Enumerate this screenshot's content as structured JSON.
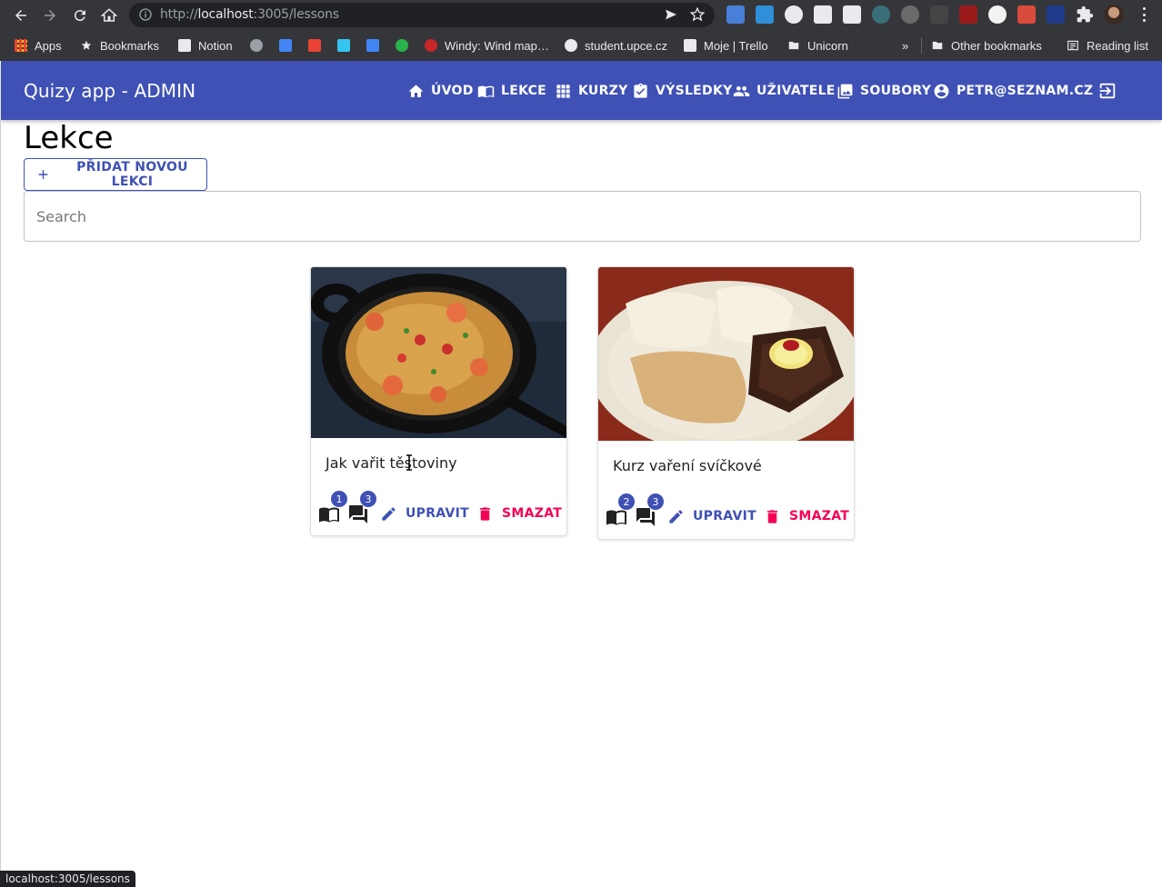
{
  "browser": {
    "url_prefix": "http://",
    "url_host": "localhost",
    "url_rest": ":3005/lessons",
    "bookmarks": {
      "apps": "Apps",
      "bookmarks": "Bookmarks",
      "notion": "Notion",
      "windy": "Windy: Wind map…",
      "student": "student.upce.cz",
      "trello": "Moje | Trello",
      "unicorn": "Unicorn",
      "more": "»",
      "other": "Other bookmarks",
      "reading": "Reading list"
    },
    "status_url": "localhost:3005/lessons"
  },
  "appbar": {
    "title": "Quizy app - ADMIN",
    "nav": {
      "uvod": "ÚVOD",
      "lekce": "LEKCE",
      "kurzy": "KURZY",
      "vysledky": "VÝSLEDKY",
      "uzivatele": "UŽIVATELE",
      "soubory": "SOUBORY",
      "user": "PETR@SEZNAM.CZ"
    }
  },
  "page": {
    "title": "Lekce",
    "add_button": "PŘIDAT NOVOU LEKCI",
    "search_placeholder": "Search"
  },
  "cards": [
    {
      "title": "Jak vařit těstoviny",
      "pages_count": "1",
      "questions_count": "3",
      "edit_label": "UPRAVIT",
      "delete_label": "SMAZAT"
    },
    {
      "title": "Kurz vaření svíčkové",
      "pages_count": "2",
      "questions_count": "3",
      "edit_label": "UPRAVIT",
      "delete_label": "SMAZAT"
    }
  ],
  "colors": {
    "primary": "#3f51b5",
    "secondary": "#f50057",
    "chrome": "#35363a"
  }
}
